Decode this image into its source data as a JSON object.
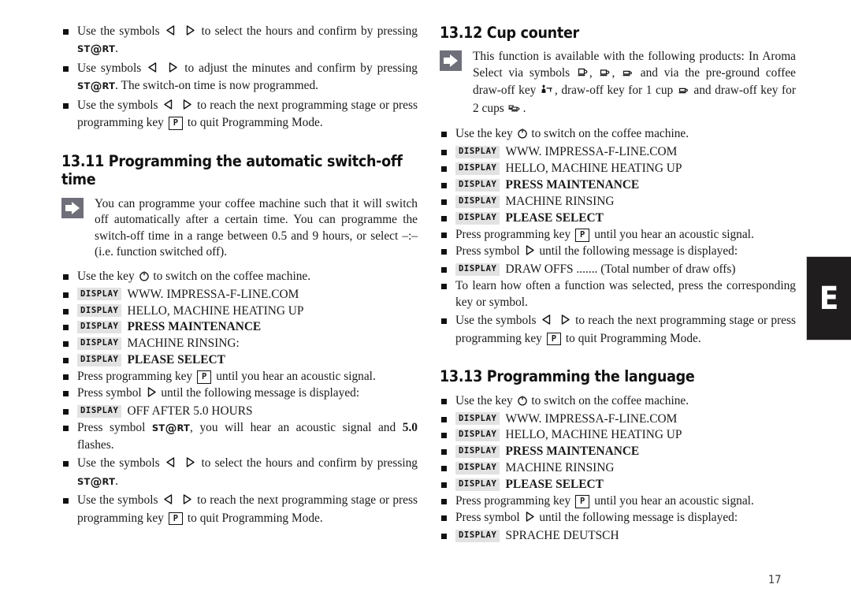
{
  "page": {
    "number": "17",
    "tab_letter": "E"
  },
  "icons": {
    "arrow_left": "triangle-left-icon",
    "arrow_right": "triangle-right-icon",
    "power": "power-key-icon",
    "note": "note-arrow-icon",
    "cup_tall": "cup-tall-icon",
    "cup_medium": "cup-medium-icon",
    "cup_small": "cup-small-icon",
    "ground_coffee": "ground-coffee-key-icon",
    "one_cup": "one-cup-draw-off-icon",
    "two_cups": "two-cups-draw-off-icon"
  },
  "labels": {
    "display_badge": "DISPLAY",
    "key_p": "P",
    "key_start_pre": "ST",
    "key_start_at": "@",
    "key_start_post": "RT"
  },
  "left_column": {
    "continued_items": [
      {
        "id": "select-hours",
        "parts": [
          "Use the symbols ",
          " to select the hours and confirm by pressing ",
          "."
        ]
      },
      {
        "id": "adjust-minutes",
        "parts": [
          "Use symbols ",
          " to adjust the minutes and confirm by pressing ",
          ". The switch-on time is now programmed."
        ]
      },
      {
        "id": "next-stage",
        "parts": [
          "Use the symbols ",
          " to reach the next programming stage or press programming key ",
          " to quit Programming Mode."
        ]
      }
    ],
    "section": {
      "number": "13.11",
      "title": "13.11 Programming the automatic switch-off time",
      "note": "You can programme your coffee machine such that it will switch off automatically after a certain time. You can programme the switch-off time in a range between 0.5 and 9 hours, or select –:– (i.e. function switched off).",
      "switch_on": {
        "before": "Use the key ",
        "after": " to switch on the coffee machine."
      },
      "display_lines": [
        {
          "text": "WWW. IMPRESSA-F-LINE.COM",
          "bold": false
        },
        {
          "text": "HELLO, MACHINE HEATING UP",
          "bold": false
        },
        {
          "text": "PRESS MAINTENANCE",
          "bold": true
        },
        {
          "text": "MACHINE RINSING:",
          "bold": false
        },
        {
          "text": "PLEASE SELECT",
          "bold": true
        }
      ],
      "press_p": {
        "before": "Press programming key ",
        "after": " until you hear an acoustic signal."
      },
      "press_symbol": {
        "before": "Press symbol ",
        "after": " until the following message is displayed:"
      },
      "off_after": {
        "text": "OFF AFTER 5.0 HOURS",
        "bold": false
      },
      "press_start": {
        "before": "Press symbol ",
        "middle": ", you will hear an acoustic signal and ",
        "bold_value": "5.0",
        "after": " flashes."
      },
      "select_hours": {
        "before": "Use the symbols ",
        "middle": " to select the hours and confirm by pressing ",
        "after": "."
      },
      "next_stage": {
        "before": "Use the symbols ",
        "middle": " to reach the next programming stage or press programming key ",
        "after": " to quit Programming Mode."
      }
    }
  },
  "right_column": {
    "cup_counter": {
      "number": "13.12",
      "title": "13.12 Cup counter",
      "note_parts": [
        "This function is available with the following products: In Aroma Select via symbols ",
        ", ",
        ", ",
        " and via the pre-ground coffee draw-off key ",
        ", draw-off key for 1 cup ",
        " and draw-off key for 2 cups ",
        "."
      ],
      "switch_on": {
        "before": "Use the key ",
        "after": " to switch on the coffee machine."
      },
      "display_lines": [
        {
          "text": "WWW. IMPRESSA-F-LINE.COM",
          "bold": false
        },
        {
          "text": "HELLO, MACHINE HEATING UP",
          "bold": false
        },
        {
          "text": "PRESS MAINTENANCE",
          "bold": true
        },
        {
          "text": "MACHINE RINSING",
          "bold": false
        },
        {
          "text": "PLEASE SELECT",
          "bold": true
        }
      ],
      "press_p": {
        "before": "Press programming key ",
        "after": " until you hear an acoustic signal."
      },
      "press_symbol": {
        "before": "Press symbol ",
        "after": " until the following message is displayed:"
      },
      "draw_offs": {
        "text": "DRAW OFFS ....... (Total number of draw offs)",
        "bold": false
      },
      "learn_often": "To learn how often a function was selected, press the corresponding key or symbol.",
      "next_stage": {
        "before": "Use the symbols ",
        "middle": " to reach the next programming stage or press programming key ",
        "after": " to quit Programming Mode."
      }
    },
    "language": {
      "number": "13.13",
      "title": "13.13 Programming the language",
      "switch_on": {
        "before": "Use the key ",
        "after": " to switch on the coffee machine."
      },
      "display_lines": [
        {
          "text": "WWW. IMPRESSA-F-LINE.COM",
          "bold": false
        },
        {
          "text": "HELLO, MACHINE HEATING UP",
          "bold": false
        },
        {
          "text": "PRESS MAINTENANCE",
          "bold": true
        },
        {
          "text": "MACHINE RINSING",
          "bold": false
        },
        {
          "text": "PLEASE SELECT",
          "bold": true
        }
      ],
      "press_p": {
        "before": "Press programming key ",
        "after": " until you hear an acoustic signal."
      },
      "press_symbol": {
        "before": "Press symbol ",
        "after": " until the following message is displayed:"
      },
      "sprache": {
        "text": "SPRACHE DEUTSCH",
        "bold": false
      }
    }
  },
  "colors": {
    "note_icon": "#6f6f7a",
    "badge_bg": "#e2e2e2",
    "tab_bg": "#1f1d1d",
    "text": "#1a1a1a"
  }
}
